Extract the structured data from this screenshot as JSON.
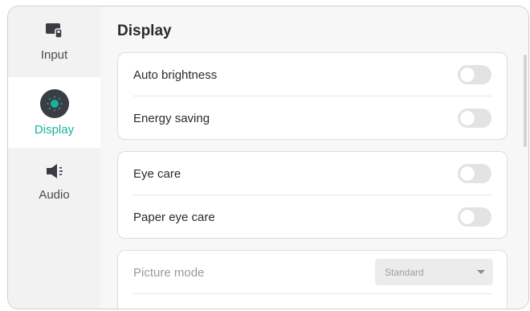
{
  "sidebar": {
    "items": [
      {
        "label": "Input",
        "icon": "input-icon",
        "active": false
      },
      {
        "label": "Display",
        "icon": "display-icon",
        "active": true
      },
      {
        "label": "Audio",
        "icon": "speaker-icon",
        "active": false
      }
    ]
  },
  "main": {
    "title": "Display",
    "groups": [
      {
        "rows": [
          {
            "label": "Auto brightness",
            "toggle": false
          },
          {
            "label": "Energy saving",
            "toggle": false
          }
        ]
      },
      {
        "rows": [
          {
            "label": "Eye care",
            "toggle": false
          },
          {
            "label": "Paper eye care",
            "toggle": false
          }
        ]
      },
      {
        "rows": [
          {
            "label": "Picture mode",
            "value": "Standard",
            "enabled": false
          }
        ]
      }
    ]
  },
  "colors": {
    "accent": "#19b39a",
    "toggle_off": "#e3e3e3",
    "icon_dark": "#3a3d44"
  }
}
